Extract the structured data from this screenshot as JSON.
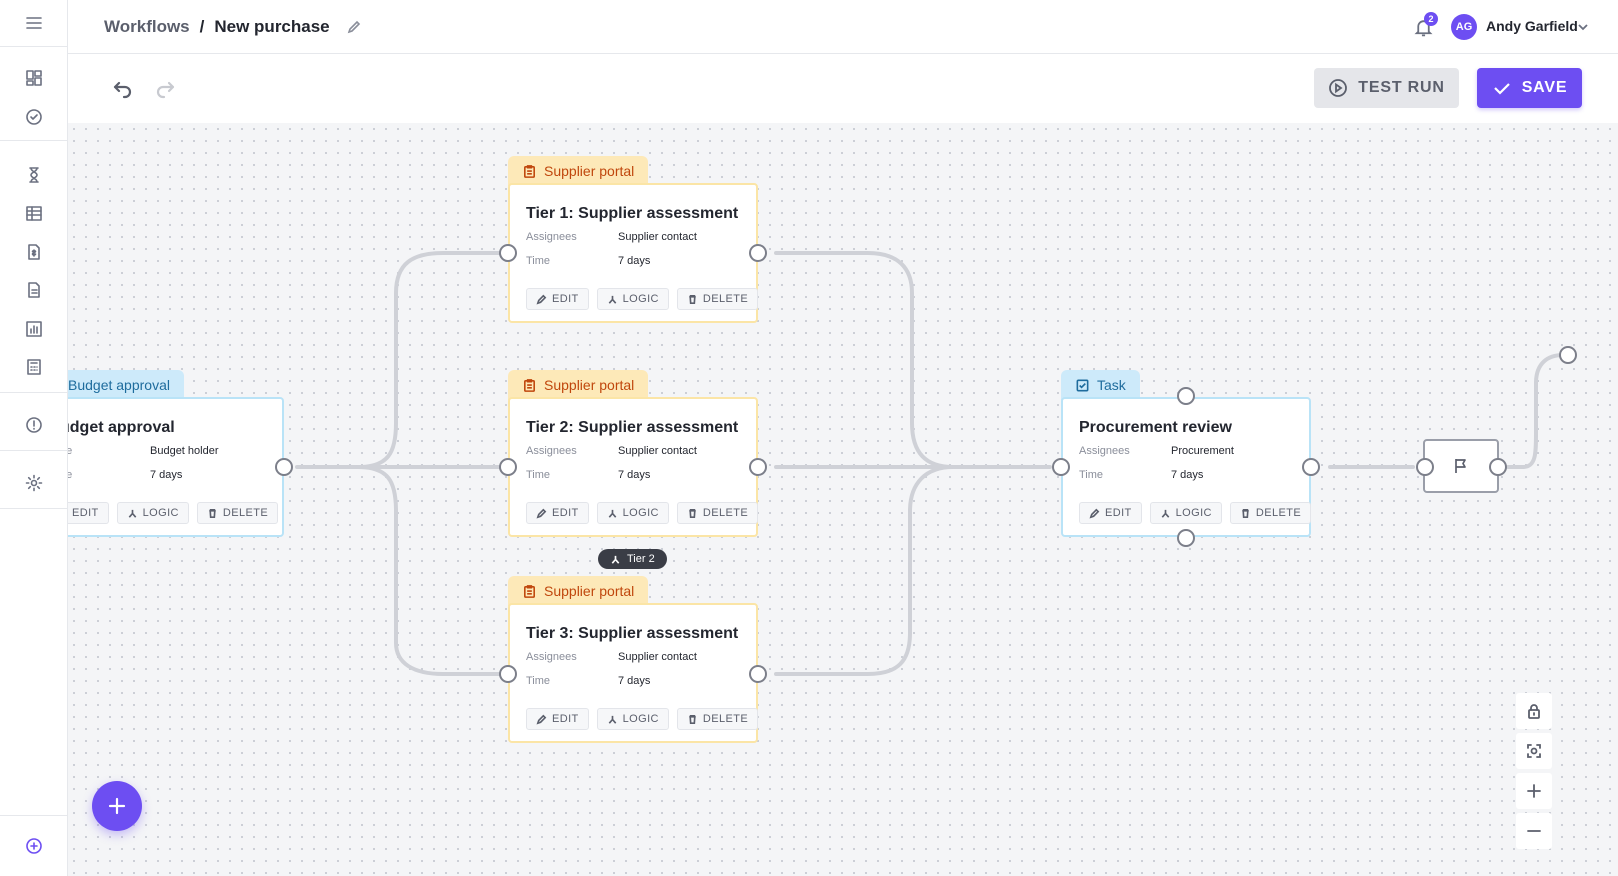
{
  "header": {
    "breadcrumb_parent": "Workflows",
    "breadcrumb_separator": "/",
    "breadcrumb_current": "New purchase",
    "notification_count": "2",
    "user_initials": "AG",
    "user_name": "Andy Garfield"
  },
  "toolbar": {
    "test_run_label": "TEST RUN",
    "save_label": "SAVE"
  },
  "colors": {
    "accent": "#6d4ef2",
    "supplier_tag_bg": "#fde9b8",
    "supplier_tag_text": "#c0470d",
    "task_tag_bg": "#cdeafa",
    "task_tag_text": "#1e6c9d"
  },
  "sidebar": {
    "icons": [
      "dashboard-icon",
      "check-circle-icon",
      "hourglass-icon",
      "building-icon",
      "invoice-icon",
      "document-icon",
      "chart-icon",
      "calculator-icon",
      "alert-icon",
      "gear-icon",
      "add-circle-icon"
    ]
  },
  "nodes": {
    "budget": {
      "tag": "Budget approval",
      "title": "udget approval",
      "row1_label": "pe",
      "row1_value": "Budget holder",
      "row2_label": "ne",
      "row2_value": "7 days",
      "edit": "EDIT",
      "logic": "LOGIC",
      "delete": "DELETE"
    },
    "tier1": {
      "tag": "Supplier portal",
      "title": "Tier 1: Supplier assessment",
      "row1_label": "Assignees",
      "row1_value": "Supplier contact",
      "row2_label": "Time",
      "row2_value": "7 days",
      "edit": "EDIT",
      "logic": "LOGIC",
      "delete": "DELETE"
    },
    "tier2": {
      "tag": "Supplier portal",
      "title": "Tier 2: Supplier assessment",
      "row1_label": "Assignees",
      "row1_value": "Supplier contact",
      "row2_label": "Time",
      "row2_value": "7 days",
      "edit": "EDIT",
      "logic": "LOGIC",
      "delete": "DELETE"
    },
    "tier3": {
      "tag": "Supplier portal",
      "title": "Tier 3: Supplier assessment",
      "row1_label": "Assignees",
      "row1_value": "Supplier contact",
      "row2_label": "Time",
      "row2_value": "7 days",
      "edit": "EDIT",
      "logic": "LOGIC",
      "delete": "DELETE"
    },
    "procurement": {
      "tag": "Task",
      "title": "Procurement review",
      "row1_label": "Assignees",
      "row1_value": "Procurement",
      "row2_label": "Time",
      "row2_value": "7 days",
      "edit": "EDIT",
      "logic": "LOGIC",
      "delete": "DELETE"
    }
  },
  "edge_badge": "Tier 2"
}
